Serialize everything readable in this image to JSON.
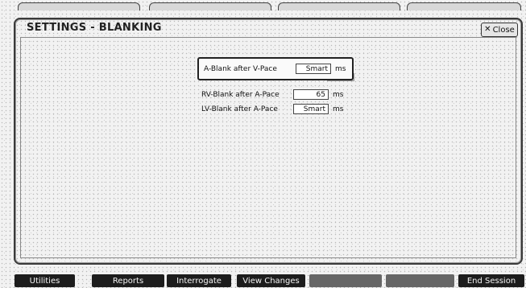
{
  "window": {
    "title": "SETTINGS - BLANKING",
    "close_label": "Close"
  },
  "settings": [
    {
      "label": "A-Blank after V-Pace",
      "value": "Smart",
      "unit": "ms",
      "selected": true
    },
    {
      "label": "RV-Blank after A-Pace",
      "value": "65",
      "unit": "ms",
      "selected": false
    },
    {
      "label": "LV-Blank after A-Pace",
      "value": "Smart",
      "unit": "ms",
      "selected": false
    }
  ],
  "bottom_nav": {
    "buttons": [
      {
        "label": "Utilities",
        "enabled": true
      },
      {
        "label": "Reports",
        "enabled": true
      },
      {
        "label": "Interrogate",
        "enabled": true
      },
      {
        "label": "View Changes",
        "enabled": true
      },
      {
        "label": "",
        "enabled": false
      },
      {
        "label": "",
        "enabled": false
      },
      {
        "label": "End Session",
        "enabled": true
      }
    ]
  }
}
